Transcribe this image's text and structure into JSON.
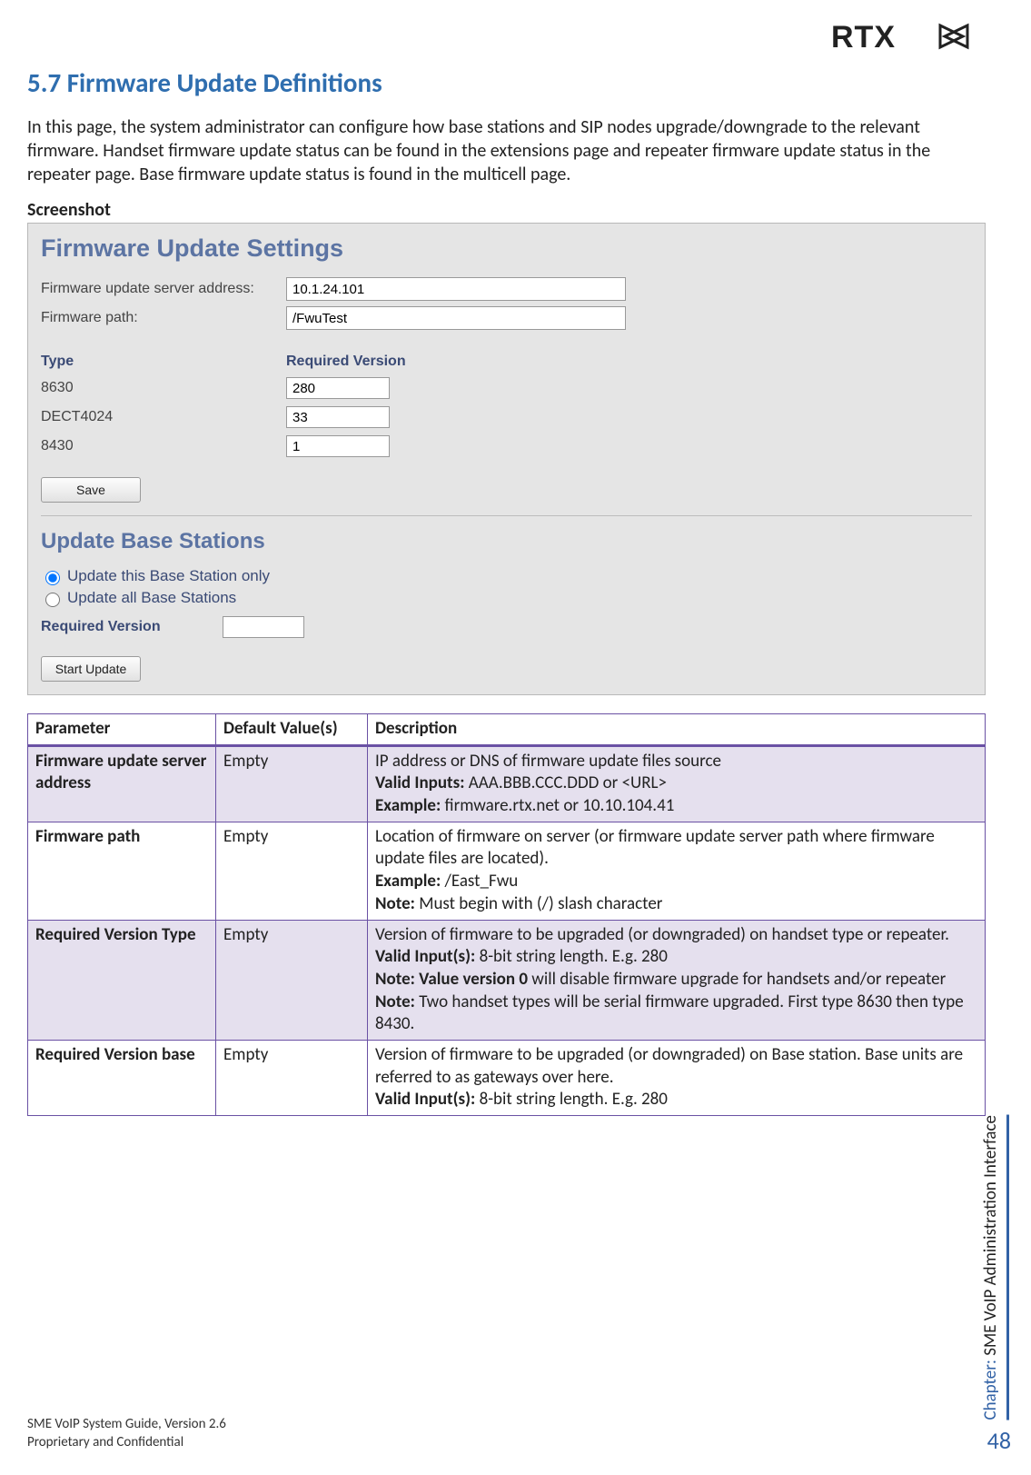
{
  "logo_text": "RTX",
  "section_title": "5.7 Firmware Update Definitions",
  "intro": "In this page, the system administrator can configure how base stations and SIP nodes upgrade/downgrade to the relevant firmware. Handset firmware update status can be found in the extensions page and repeater firmware update status in the repeater page. Base firmware update status is found in the multicell page.",
  "screenshot_label": "Screenshot",
  "screenshot": {
    "heading": "Firmware Update Settings",
    "server_label": "Firmware update server address:",
    "server_value": "10.1.24.101",
    "path_label": "Firmware path:",
    "path_value": "/FwuTest",
    "col_type": "Type",
    "col_required": "Required Version",
    "rows": [
      {
        "type": "8630",
        "version": "280"
      },
      {
        "type": "DECT4024",
        "version": "33"
      },
      {
        "type": "8430",
        "version": "1"
      }
    ],
    "save_label": "Save",
    "ub_heading": "Update Base Stations",
    "radio1": "Update this Base Station only",
    "radio2": "Update all Base Stations",
    "required_version_label": "Required Version",
    "required_version_value": "",
    "start_label": "Start Update"
  },
  "table": {
    "headers": [
      "Parameter",
      "Default Value(s)",
      "Description"
    ],
    "rows": [
      {
        "shade": true,
        "param": "Firmware update server address",
        "default": "Empty",
        "desc": {
          "l1": "IP address or DNS of firmware update files source",
          "l2b": "Valid Inputs:",
          "l2": " AAA.BBB.CCC.DDD or <URL>",
          "l3b": "Example:",
          "l3": " firmware.rtx.net or 10.10.104.41"
        }
      },
      {
        "shade": false,
        "param": "Firmware path",
        "default": "Empty",
        "desc": {
          "l1": "Location of firmware on server (or firmware update server path where firmware update files are located).",
          "l2b": "Example:",
          "l2": " /East_Fwu",
          "l3b": "Note:",
          "l3": " Must begin with (/) slash character"
        }
      },
      {
        "shade": true,
        "param": "Required Version Type",
        "default": "Empty",
        "desc": {
          "l1": "Version of firmware to be upgraded (or downgraded) on handset type or repeater.",
          "l2b": "Valid Input(s):",
          "l2": " 8-bit string length. E.g. 280",
          "l3b": "Note: Value version 0",
          "l3": " will disable firmware upgrade for handsets and/or repeater",
          "l4b": "Note:",
          "l4": " Two handset types will be serial firmware upgraded. First type 8630 then type 8430."
        }
      },
      {
        "shade": false,
        "param": "Required Version base",
        "default": "Empty",
        "desc": {
          "l1": "Version of firmware to be upgraded (or downgraded) on Base station. Base units are referred to as gateways over here.",
          "l2b": "Valid Input(s):",
          "l2": " 8-bit string length. E.g. 280"
        }
      }
    ]
  },
  "chapter_prefix": "Chapter: ",
  "chapter_title": "SME VoIP Administration Interface",
  "page_number": "48",
  "footer1": "SME VoIP System Guide, Version 2.6",
  "footer2": "Proprietary and Confidential"
}
